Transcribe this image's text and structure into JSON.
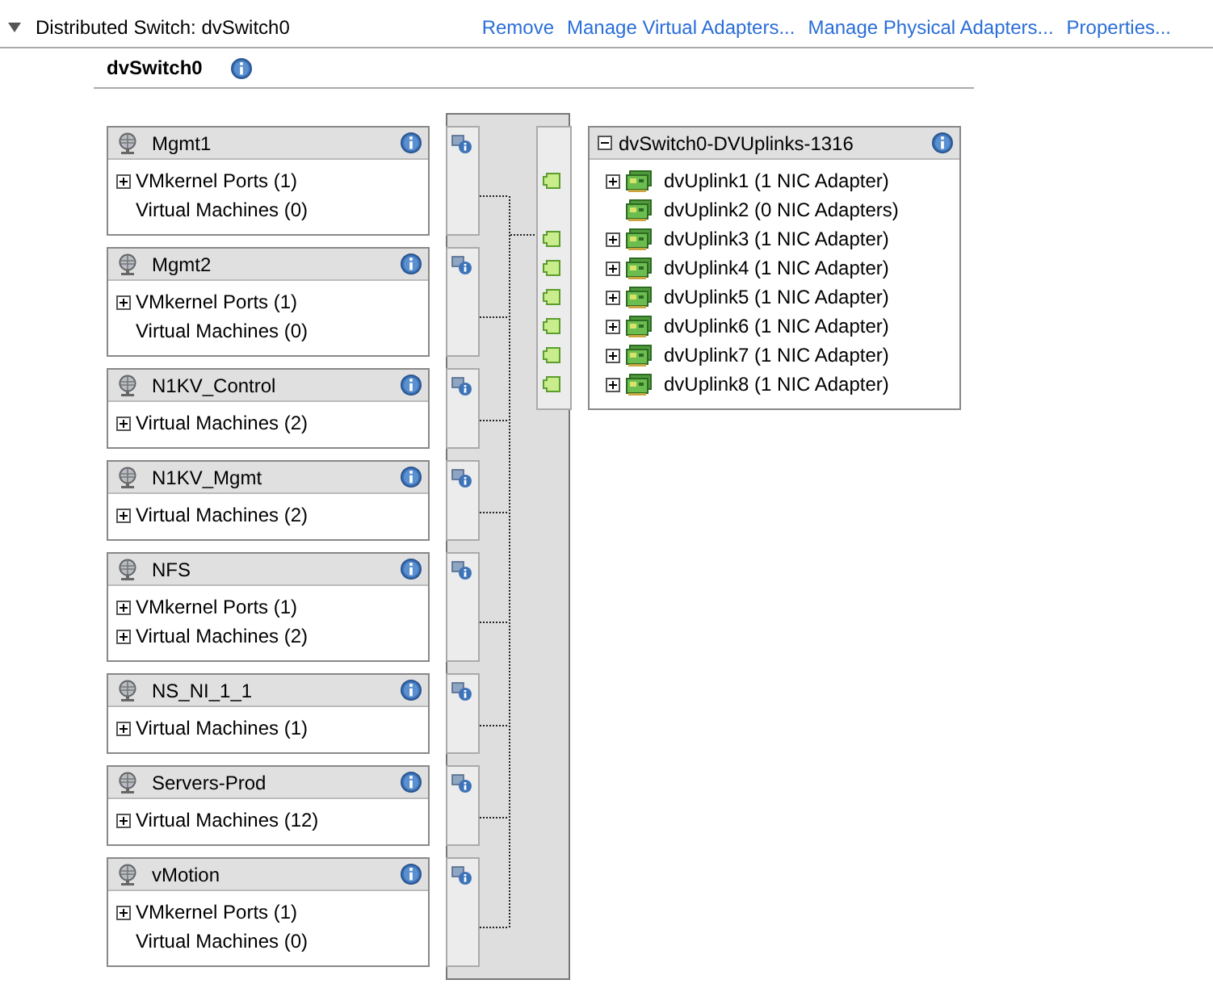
{
  "header": {
    "title": "Distributed Switch: dvSwitch0",
    "expanded": true,
    "actions": [
      "Remove",
      "Manage Virtual Adapters...",
      "Manage Physical Adapters...",
      "Properties..."
    ]
  },
  "switch": {
    "name": "dvSwitch0"
  },
  "port_groups": [
    {
      "name": "Mgmt1",
      "items": [
        {
          "label": "VMkernel Ports (1)",
          "expandable": true
        },
        {
          "label": "Virtual Machines (0)",
          "expandable": false
        }
      ]
    },
    {
      "name": "Mgmt2",
      "items": [
        {
          "label": "VMkernel Ports (1)",
          "expandable": true
        },
        {
          "label": "Virtual Machines (0)",
          "expandable": false
        }
      ]
    },
    {
      "name": "N1KV_Control",
      "items": [
        {
          "label": "Virtual Machines (2)",
          "expandable": true
        }
      ]
    },
    {
      "name": "N1KV_Mgmt",
      "items": [
        {
          "label": "Virtual Machines (2)",
          "expandable": true
        }
      ]
    },
    {
      "name": "NFS",
      "items": [
        {
          "label": "VMkernel Ports (1)",
          "expandable": true
        },
        {
          "label": "Virtual Machines (2)",
          "expandable": true
        }
      ]
    },
    {
      "name": "NS_NI_1_1",
      "items": [
        {
          "label": "Virtual Machines (1)",
          "expandable": true
        }
      ]
    },
    {
      "name": "Servers-Prod",
      "items": [
        {
          "label": "Virtual Machines (12)",
          "expandable": true
        }
      ]
    },
    {
      "name": "vMotion",
      "items": [
        {
          "label": "VMkernel Ports (1)",
          "expandable": true
        },
        {
          "label": "Virtual Machines (0)",
          "expandable": false
        }
      ]
    }
  ],
  "uplink_group": {
    "name": "dvSwitch0-DVUplinks-1316",
    "expanded": true,
    "uplinks": [
      {
        "label": "dvUplink1 (1 NIC Adapter)",
        "has_adapters": true
      },
      {
        "label": "dvUplink2 (0 NIC Adapters)",
        "has_adapters": false
      },
      {
        "label": "dvUplink3 (1 NIC Adapter)",
        "has_adapters": true
      },
      {
        "label": "dvUplink4 (1 NIC Adapter)",
        "has_adapters": true
      },
      {
        "label": "dvUplink5 (1 NIC Adapter)",
        "has_adapters": true
      },
      {
        "label": "dvUplink6 (1 NIC Adapter)",
        "has_adapters": true
      },
      {
        "label": "dvUplink7 (1 NIC Adapter)",
        "has_adapters": true
      },
      {
        "label": "dvUplink8 (1 NIC Adapter)",
        "has_adapters": true
      }
    ]
  }
}
